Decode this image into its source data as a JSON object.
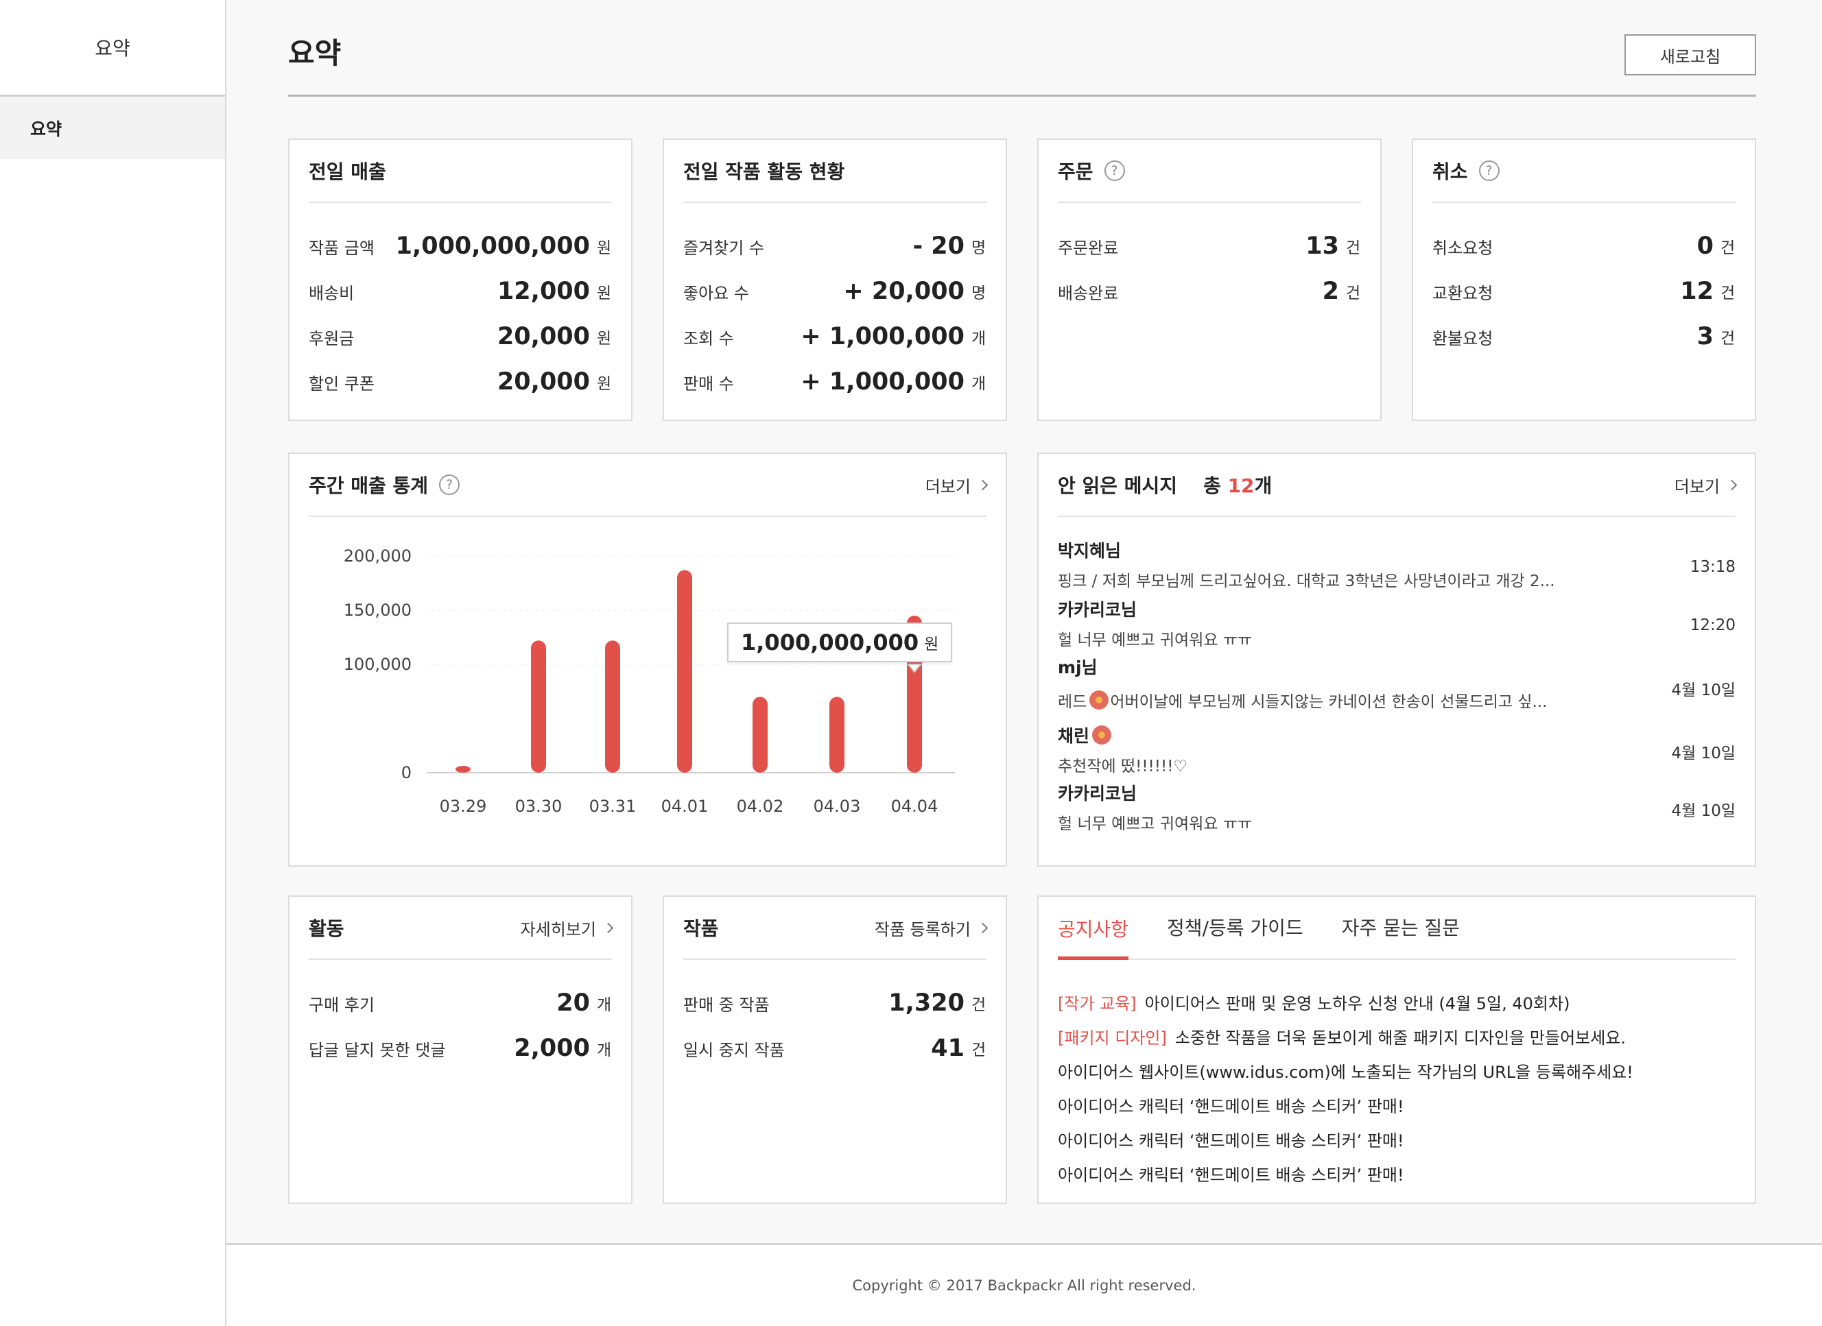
{
  "sidebar": {
    "title": "요약",
    "items": [
      {
        "label": "요약"
      }
    ]
  },
  "header": {
    "title": "요약",
    "refresh_label": "새로고침"
  },
  "sales": {
    "title": "전일 매출",
    "rows": [
      {
        "label": "작품 금액",
        "value": "1,000,000,000",
        "unit": "원"
      },
      {
        "label": "배송비",
        "value": "12,000",
        "unit": "원"
      },
      {
        "label": "후원금",
        "value": "20,000",
        "unit": "원"
      },
      {
        "label": "할인 쿠폰",
        "value": "20,000",
        "unit": "원"
      }
    ]
  },
  "activity_status": {
    "title": "전일 작품 활동 현황",
    "rows": [
      {
        "label": "즐겨찾기 수",
        "value": "- 20",
        "unit": "명"
      },
      {
        "label": "좋아요 수",
        "value": "+ 20,000",
        "unit": "명"
      },
      {
        "label": "조회 수",
        "value": "+ 1,000,000",
        "unit": "개"
      },
      {
        "label": "판매 수",
        "value": "+ 1,000,000",
        "unit": "개"
      }
    ]
  },
  "orders": {
    "title": "주문",
    "help_icon": "question-circle-icon",
    "rows": [
      {
        "label": "주문완료",
        "value": "13",
        "unit": "건"
      },
      {
        "label": "배송완료",
        "value": "2",
        "unit": "건"
      }
    ]
  },
  "cancels": {
    "title": "취소",
    "help_icon": "question-circle-icon",
    "rows": [
      {
        "label": "취소요청",
        "value": "0",
        "unit": "건"
      },
      {
        "label": "교환요청",
        "value": "12",
        "unit": "건"
      },
      {
        "label": "환불요청",
        "value": "3",
        "unit": "건"
      }
    ]
  },
  "weekly": {
    "title": "주간 매출 통계",
    "more_label": "더보기",
    "tooltip_value": "1,000,000,000",
    "tooltip_unit": "원"
  },
  "chart_data": {
    "type": "bar",
    "title": "주간 매출 통계",
    "categories": [
      "03.29",
      "03.30",
      "03.31",
      "04.01",
      "04.02",
      "04.03",
      "04.04"
    ],
    "values": [
      2000,
      122000,
      122000,
      187000,
      70000,
      70000,
      145000
    ],
    "yticks": [
      0,
      100000,
      150000,
      200000
    ],
    "ytick_labels": [
      "0",
      "100,000",
      "150,000",
      "200,000"
    ],
    "ylim": [
      0,
      200000
    ],
    "color": "#e2504a",
    "grid": true
  },
  "messages": {
    "title": "안 읽은 메시지",
    "count_prefix": "총",
    "count_num": "12",
    "count_suffix": "개",
    "more_label": "더보기",
    "items": [
      {
        "sender": "박지혜님",
        "text": "핑크 / 저희 부모님께 드리고싶어요. 대학교 3학년은 사망년이라고 개강 2...",
        "time": "13:18"
      },
      {
        "sender": "카카리코님",
        "text": "헐 너무 예쁘고 귀여워요 ㅠㅠ",
        "time": "12:20"
      },
      {
        "sender": "mj님",
        "text_before": "레드",
        "text_after": " 어버이날에 부모님께 시들지않는 카네이션 한송이 선물드리고 싶...",
        "time": "4월 10일"
      },
      {
        "sender": "채린",
        "text": "추천작에 떴!!!!!!♡",
        "time": "4월 10일"
      },
      {
        "sender": "카카리코님",
        "text": "헐 너무 예쁘고 귀여워요 ㅠㅠ",
        "time": "4월 10일"
      }
    ]
  },
  "activity": {
    "title": "활동",
    "more_label": "자세히보기",
    "rows": [
      {
        "label": "구매 후기",
        "value": "20",
        "unit": "개"
      },
      {
        "label": "답글 달지 못한 댓글",
        "value": "2,000",
        "unit": "개"
      }
    ]
  },
  "works": {
    "title": "작품",
    "more_label": "작품 등록하기",
    "rows": [
      {
        "label": "판매 중 작품",
        "value": "1,320",
        "unit": "건"
      },
      {
        "label": "일시 중지 작품",
        "value": "41",
        "unit": "건"
      }
    ]
  },
  "notices": {
    "tabs": [
      {
        "label": "공지사항",
        "active": true
      },
      {
        "label": "정책/등록 가이드",
        "active": false
      },
      {
        "label": "자주 묻는 질문",
        "active": false
      }
    ],
    "items": [
      {
        "tag": "[작가 교육]",
        "text": "아이디어스 판매 및 운영 노하우 신청 안내 (4월 5일, 40회차)"
      },
      {
        "tag": "[패키지 디자인]",
        "text": "소중한 작품을 더욱 돋보이게 해줄 패키지 디자인을 만들어보세요."
      },
      {
        "tag": "",
        "text": "아이디어스 웹사이트(www.idus.com)에 노출되는 작가님의 URL을 등록해주세요!"
      },
      {
        "tag": "",
        "text": "아이디어스 캐릭터 ‘핸드메이트 배송 스티커’ 판매!"
      },
      {
        "tag": "",
        "text": "아이디어스 캐릭터 ‘핸드메이트 배송 스티커’ 판매!"
      },
      {
        "tag": "",
        "text": "아이디어스 캐릭터 ‘핸드메이트 배송 스티커’ 판매!"
      }
    ]
  },
  "footer": {
    "copyright": "Copyright © 2017 Backpackr All right reserved."
  }
}
